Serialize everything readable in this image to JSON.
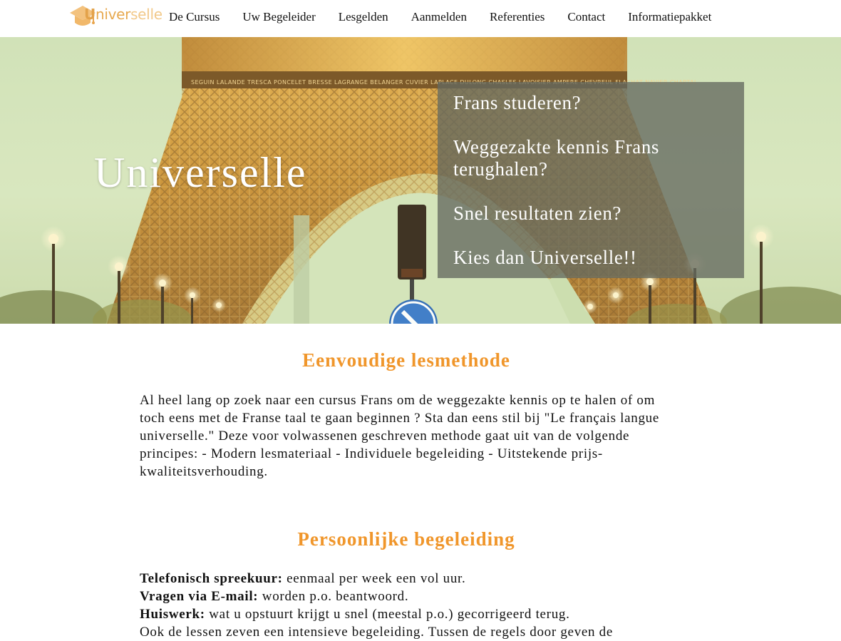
{
  "nav": {
    "logo_parts": [
      "U",
      "niver",
      "selle"
    ],
    "items": [
      {
        "label": "De Cursus"
      },
      {
        "label": "Uw Begeleider"
      },
      {
        "label": "Lesgelden"
      },
      {
        "label": "Aanmelden"
      },
      {
        "label": "Referenties"
      },
      {
        "label": "Contact"
      },
      {
        "label": "Informatiepakket"
      }
    ]
  },
  "hero": {
    "title": "Universelle",
    "lines": [
      "Frans studeren?",
      "Weggezakte kennis Frans terughalen?",
      "Snel resultaten zien?",
      "Kies dan Universelle!!"
    ],
    "names_on_tower": "SEGUIN  LALANDE  TRESCA  PONCELET  BRESSE  LAGRANGE  BELANGER  CUVIER  LAPLACE  DULONG  CHASLES  LAVOISIER  AMPERE  CHEVREUL  FLACHAT  NAVIER  CHAPTAL"
  },
  "section1": {
    "heading": "Eenvoudige lesmethode",
    "body": "Al heel lang op zoek naar een cursus Frans om de weggezakte kennis op te halen of om toch eens met de Franse taal te gaan beginnen ? Sta dan eens stil bij \"Le français langue universelle.\" Deze voor volwassenen geschreven methode gaat uit van de volgende principes: - Modern lesmateriaal - Individuele begeleiding - Uitstekende prijs-kwaliteitsverhouding."
  },
  "section2": {
    "heading": "Persoonlijke begeleiding",
    "items": [
      {
        "label": "Telefonisch spreekuur:",
        "text": " eenmaal per week een vol uur."
      },
      {
        "label": "Vragen via E-mail:",
        "text": " worden p.o. beantwoord."
      },
      {
        "label": "Huiswerk:",
        "text": " wat u opstuurt krijgt u snel (meestal p.o.) gecorrigeerd terug."
      }
    ],
    "more": "Ook de lessen zeven een intensieve begeleiding. Tussen de regels door geven de"
  },
  "colors": {
    "accent": "#f0962b",
    "logo": "#e3a24a",
    "overlay": "#64695f"
  }
}
